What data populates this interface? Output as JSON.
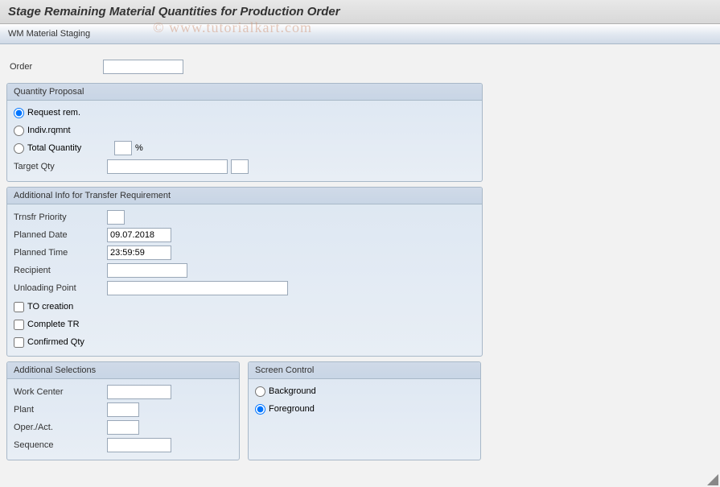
{
  "title": "Stage Remaining Material Quantities for Production Order",
  "toolbar": {
    "staging_label": "WM Material Staging"
  },
  "watermark": "© www.tutorialkart.com",
  "order": {
    "label": "Order",
    "value": ""
  },
  "quantity_proposal": {
    "legend": "Quantity Proposal",
    "request_rem_label": "Request rem.",
    "indiv_rqmnt_label": "Indiv.rqmnt",
    "total_qty_label": "Total Quantity",
    "total_qty_pct": "",
    "pct_sign": "%",
    "target_qty_label": "Target Qty",
    "target_qty_value": "",
    "target_qty_unit": "",
    "selected": "request_rem"
  },
  "transfer_req": {
    "legend": "Additional Info for Transfer Requirement",
    "trnsfr_priority_label": "Trnsfr Priority",
    "trnsfr_priority_value": "",
    "planned_date_label": "Planned Date",
    "planned_date_value": "09.07.2018",
    "planned_time_label": "Planned Time",
    "planned_time_value": "23:59:59",
    "recipient_label": "Recipient",
    "recipient_value": "",
    "unloading_point_label": "Unloading Point",
    "unloading_point_value": "",
    "to_creation_label": "TO creation",
    "complete_tr_label": "Complete TR",
    "confirmed_qty_label": "Confirmed Qty"
  },
  "additional_selections": {
    "legend": "Additional Selections",
    "work_center_label": "Work Center",
    "work_center_value": "",
    "plant_label": "Plant",
    "plant_value": "",
    "oper_act_label": "Oper./Act.",
    "oper_act_value": "",
    "sequence_label": "Sequence",
    "sequence_value": ""
  },
  "screen_control": {
    "legend": "Screen Control",
    "background_label": "Background",
    "foreground_label": "Foreground",
    "selected": "foreground"
  }
}
